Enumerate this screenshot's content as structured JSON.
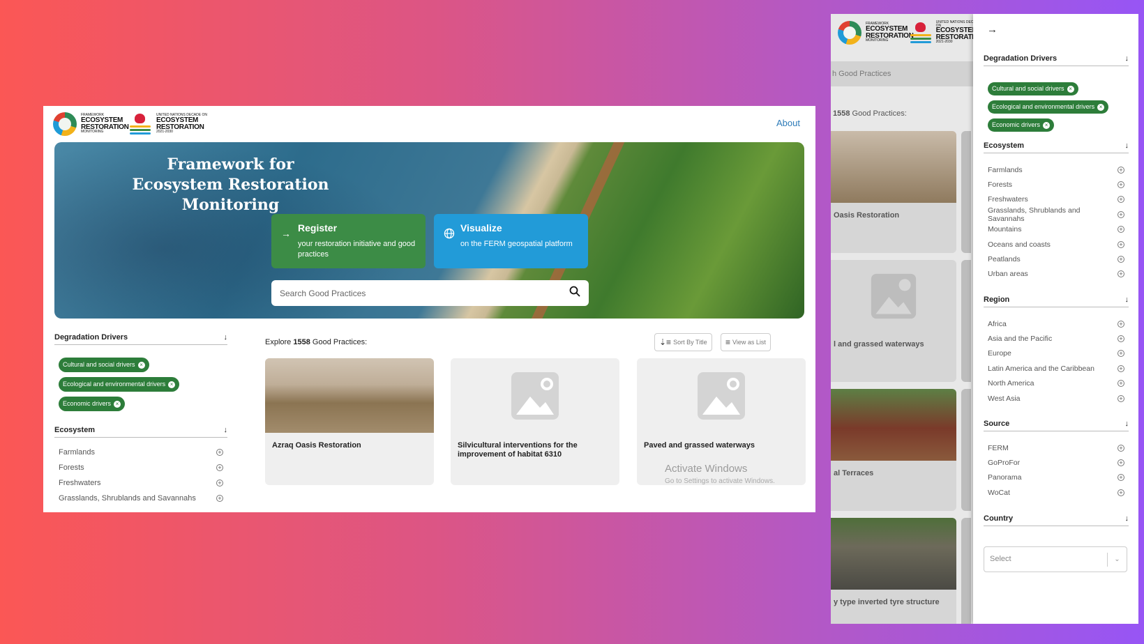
{
  "main": {
    "nav": {
      "about": "About"
    },
    "logo1": {
      "small": "FRAMEWORK",
      "line1": "ECOSYSTEM",
      "line2": "RESTORATION",
      "line3": "MONITORING"
    },
    "logo2": {
      "small": "UNITED NATIONS DECADE ON",
      "line1": "ECOSYSTEM",
      "line2": "RESTORATION",
      "line3": "2021-2030"
    },
    "hero": {
      "title": "Framework for Ecosystem Restoration Monitoring",
      "register": {
        "title": "Register",
        "desc": "your restoration initiative and good practices",
        "icon": "arrow-right-icon"
      },
      "visualize": {
        "title": "Visualize",
        "desc": "on the FERM geospatial platform",
        "icon": "globe-icon"
      },
      "search": {
        "placeholder": "Search Good Practices",
        "icon": "search-icon"
      }
    },
    "sidebar": {
      "degradation": {
        "label": "Degradation Drivers",
        "chips": [
          "Cultural and social drivers",
          "Ecological and environmental drivers",
          "Economic drivers"
        ]
      },
      "ecosystem": {
        "label": "Ecosystem",
        "items": [
          "Farmlands",
          "Forests",
          "Freshwaters",
          "Grasslands, Shrublands and Savannahs"
        ]
      }
    },
    "content": {
      "explore_prefix": "Explore",
      "count": "1558",
      "explore_suffix": "Good Practices:",
      "sort_label": "Sort By Title",
      "view_label": "View as List",
      "cards": [
        {
          "title": "Azraq Oasis Restoration"
        },
        {
          "title": "Silvicultural interventions for the improvement of habitat 6310"
        },
        {
          "title": "Paved and grassed waterways"
        }
      ]
    },
    "watermark": {
      "title": "Activate Windows",
      "sub": "Go to Settings to activate Windows."
    }
  },
  "side": {
    "bg": {
      "tab": "h Good Practices",
      "count": "1558",
      "count_suffix": "Good Practices:",
      "cards": [
        "Oasis Restoration",
        "l and grassed waterways",
        "al Terraces",
        "y type inverted tyre structure"
      ]
    },
    "panel": {
      "degradation": {
        "label": "Degradation Drivers",
        "chips": [
          "Cultural and social drivers",
          "Ecological and environmental drivers",
          "Economic drivers"
        ]
      },
      "ecosystem": {
        "label": "Ecosystem",
        "items": [
          "Farmlands",
          "Forests",
          "Freshwaters",
          "Grasslands, Shrublands and Savannahs",
          "Mountains",
          "Oceans and coasts",
          "Peatlands",
          "Urban areas"
        ]
      },
      "region": {
        "label": "Region",
        "items": [
          "Africa",
          "Asia and the Pacific",
          "Europe",
          "Latin America and the Caribbean",
          "North America",
          "West Asia"
        ]
      },
      "source": {
        "label": "Source",
        "items": [
          "FERM",
          "GoProFor",
          "Panorama",
          "WoCat"
        ]
      },
      "country": {
        "label": "Country",
        "placeholder": "Select"
      }
    }
  },
  "colors": {
    "green": "#3c8c46",
    "blue": "#229bd8",
    "chip": "#2d7d3a",
    "link": "#2d7bb8"
  }
}
